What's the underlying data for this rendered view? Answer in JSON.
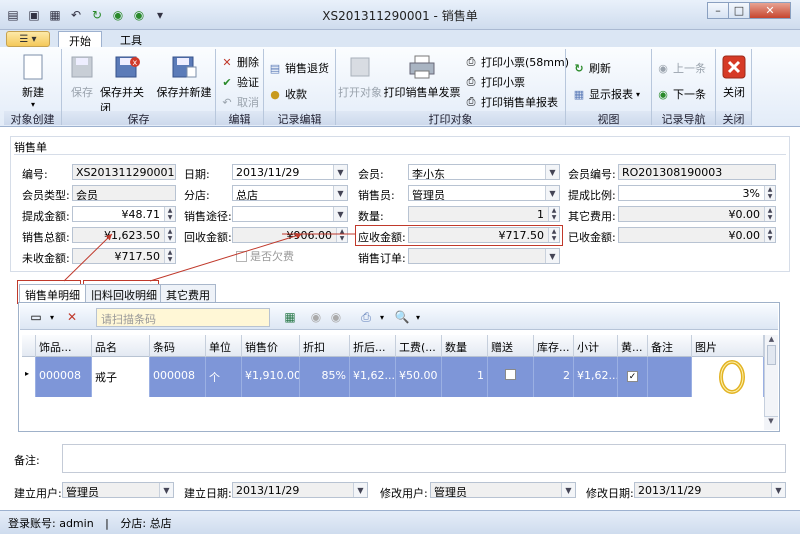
{
  "window": {
    "title": "XS201311290001 - 销售单"
  },
  "ribbon": {
    "tabs": [
      "开始",
      "工具"
    ],
    "groups": {
      "create": {
        "name": "对象创建",
        "new": "新建"
      },
      "save": {
        "name": "保存",
        "save": "保存",
        "save_close": "保存并关闭",
        "save_new": "保存并新建"
      },
      "edit": {
        "name": "编辑",
        "delete": "删除",
        "verify": "验证",
        "cancel": "取消"
      },
      "record_edit": {
        "name": "记录编辑",
        "return": "销售退货",
        "collect": "收款"
      },
      "print": {
        "name": "打印对象",
        "open": "打开对象",
        "print_invoice": "打印销售单发票",
        "print_58": "打印小票(58mm)",
        "print_ticket": "打印小票",
        "print_report": "打印销售单报表"
      },
      "view": {
        "name": "视图",
        "refresh": "刷新",
        "show_report": "显示报表"
      },
      "nav": {
        "name": "记录导航",
        "prev": "上一条",
        "next": "下一条"
      },
      "close": {
        "name": "关闭",
        "close": "关闭"
      }
    }
  },
  "form": {
    "section_title": "销售单",
    "labels": {
      "no": "编号:",
      "date": "日期:",
      "member": "会员:",
      "member_no": "会员编号:",
      "member_type": "会员类型:",
      "store": "分店:",
      "salesperson": "销售员:",
      "commission_rate": "提成比例:",
      "commission_amount": "提成金额:",
      "channel": "销售途径:",
      "qty": "数量:",
      "other_fee": "其它费用:",
      "total": "销售总额:",
      "recycle": "回收金额:",
      "receivable": "应收金额:",
      "received": "已收金额:",
      "unreceived": "未收金额:",
      "include_debt": "是否欠费",
      "order": "销售订单:"
    },
    "values": {
      "no": "XS201311290001",
      "date": "2013/11/29",
      "member": "李小东",
      "member_no": "RO201308190003",
      "member_type": "会员",
      "store": "总店",
      "salesperson": "管理员",
      "commission_rate": "3%",
      "commission_amount": "¥48.71",
      "channel": "",
      "qty": "1",
      "other_fee": "¥0.00",
      "total": "¥1,623.50",
      "recycle": "¥906.00",
      "receivable": "¥717.50",
      "received": "¥0.00",
      "unreceived": "¥717.50",
      "order": ""
    }
  },
  "subtabs": [
    "销售单明细",
    "旧料回收明细",
    "其它费用"
  ],
  "grid": {
    "scan_placeholder": "请扫描条码",
    "columns": [
      "饰品...",
      "品名",
      "条码",
      "单位",
      "销售价",
      "折扣",
      "折后...",
      "工费(...",
      "数量",
      "赠送",
      "库存...",
      "小计",
      "黄...",
      "备注",
      "图片"
    ],
    "row": {
      "code": "000008",
      "name": "戒子",
      "barcode": "000008",
      "unit": "个",
      "price": "¥1,910.00",
      "discount": "85%",
      "after": "¥1,62...",
      "labor": "¥50.00",
      "qty": "1",
      "gift": false,
      "stock": "2",
      "subtotal": "¥1,62...",
      "gold": true,
      "remark": ""
    }
  },
  "note": {
    "label": "备注:"
  },
  "bottom": {
    "created_by_label": "建立用户:",
    "created_by": "管理员",
    "created_date_label": "建立日期:",
    "created_date": "2013/11/29",
    "modified_by_label": "修改用户:",
    "modified_by": "管理员",
    "modified_date_label": "修改日期:",
    "modified_date": "2013/11/29"
  },
  "status": {
    "account": "登录账号: admin",
    "sep": "|",
    "store": "分店: 总店"
  },
  "colors": {
    "accent": "#7e96d8",
    "annotation": "#c0392b",
    "ribbon": "#dbe6f4"
  },
  "icons": [
    "app-menu-icon",
    "save-icon",
    "undo-icon",
    "refresh-icon",
    "new-doc-icon",
    "delete-icon",
    "check-icon",
    "print-icon",
    "arrow-up-icon",
    "arrow-down-icon",
    "close-icon",
    "ring-image"
  ]
}
